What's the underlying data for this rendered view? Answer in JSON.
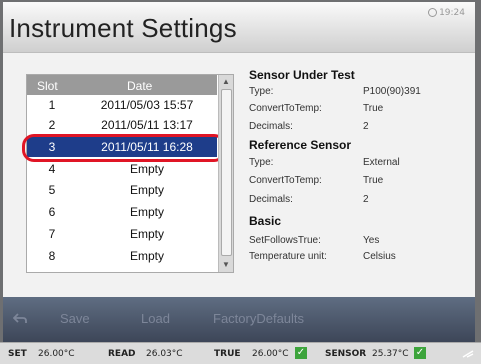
{
  "window": {
    "title": "Instrument Settings",
    "clock": "19:24"
  },
  "list": {
    "headers": {
      "slot": "Slot",
      "date": "Date"
    },
    "rows": [
      {
        "slot": "1",
        "date": "2011/05/03 15:57"
      },
      {
        "slot": "2",
        "date": "2011/05/11 13:17"
      },
      {
        "slot": "3",
        "date": "2011/05/11 16:28",
        "selected": true
      },
      {
        "slot": "4",
        "date": "Empty"
      },
      {
        "slot": "5",
        "date": "Empty"
      },
      {
        "slot": "6",
        "date": "Empty"
      },
      {
        "slot": "7",
        "date": "Empty"
      },
      {
        "slot": "8",
        "date": "Empty"
      }
    ]
  },
  "sensor_under_test": {
    "title": "Sensor Under Test",
    "type_label": "Type:",
    "type_value": "P100(90)391",
    "convert_label": "ConvertToTemp:",
    "convert_value": "True",
    "decimals_label": "Decimals:",
    "decimals_value": "2"
  },
  "reference_sensor": {
    "title": "Reference Sensor",
    "type_label": "Type:",
    "type_value": "External",
    "convert_label": "ConvertToTemp:",
    "convert_value": "True",
    "decimals_label": "Decimals:",
    "decimals_value": "2"
  },
  "basic": {
    "title": "Basic",
    "setfollows_label": "SetFollowsTrue:",
    "setfollows_value": "Yes",
    "unit_label": "Temperature unit:",
    "unit_value": "Celsius"
  },
  "toolbar": {
    "save": "Save",
    "load": "Load",
    "factory": "FactoryDefaults"
  },
  "status": {
    "set_label": "SET",
    "set_value": "26.00°C",
    "read_label": "READ",
    "read_value": "26.03°C",
    "true_label": "TRUE",
    "true_value": "26.00°C",
    "sensor_label": "SENSOR",
    "sensor_value": "25.37°C"
  },
  "colors": {
    "selection": "#1e3d8a",
    "highlight_ring": "#e01525",
    "check": "#3da43c"
  }
}
